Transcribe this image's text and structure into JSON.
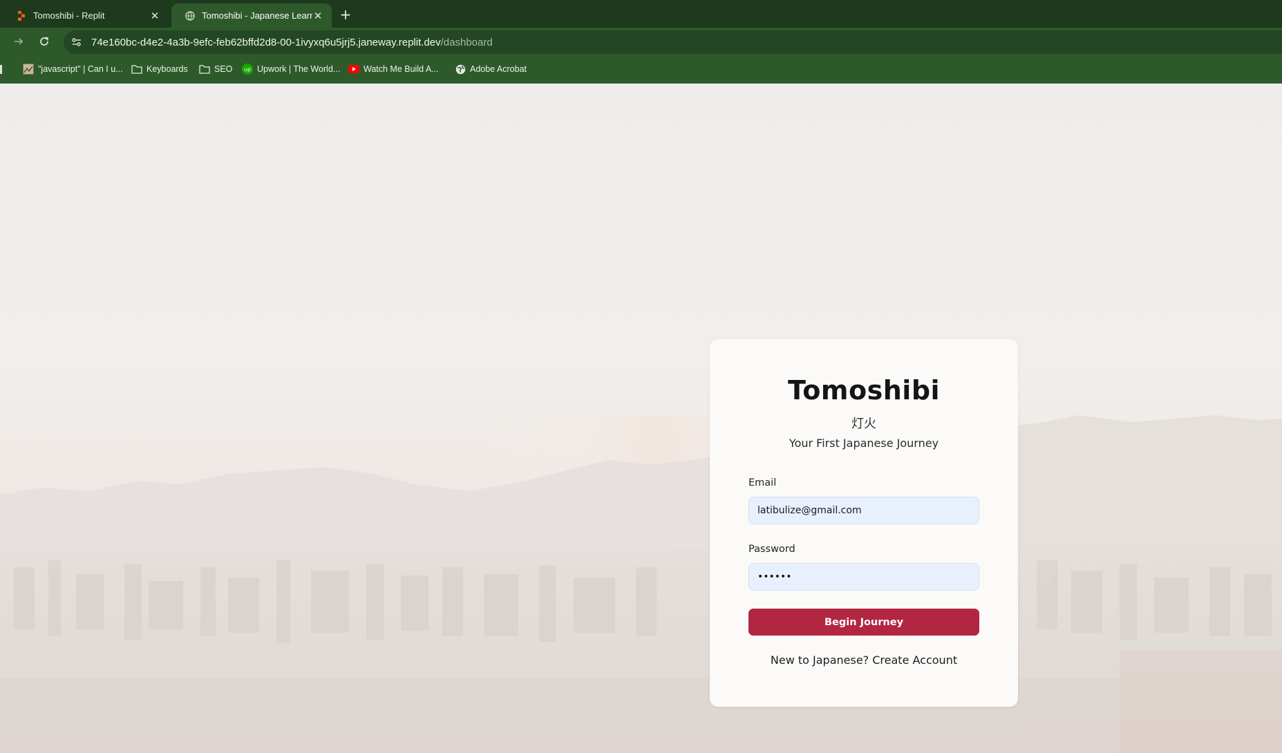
{
  "browser": {
    "tabs": [
      {
        "title": "Tomoshibi - Replit",
        "icon": "replit-icon",
        "active": false
      },
      {
        "title": "Tomoshibi - Japanese Learning",
        "icon": "globe-icon",
        "active": true
      }
    ],
    "new_tab_symbol": "+",
    "close_symbol": "✕",
    "url_host": "74e160bc-d4e2-4a3b-9efc-feb62bffd2d8-00-1ivyxq6u5jrj5.janeway.replit.dev",
    "url_path": "/dashboard",
    "bookmarks": [
      {
        "label": "\"javascript\" | Can I u...",
        "icon": "caniuse-icon"
      },
      {
        "label": "Keyboards",
        "icon": "folder-icon"
      },
      {
        "label": "SEO",
        "icon": "folder-icon"
      },
      {
        "label": "Upwork | The World...",
        "icon": "upwork-icon"
      },
      {
        "label": "Watch Me Build A...",
        "icon": "youtube-icon"
      },
      {
        "label": "Adobe Acrobat",
        "icon": "globe-icon"
      }
    ],
    "colors": {
      "tabbar": "#1e3a1e",
      "toolbar": "#2e5a2b"
    }
  },
  "login": {
    "title": "Tomoshibi",
    "title_kanji": "灯火",
    "tagline": "Your First Japanese Journey",
    "email_label": "Email",
    "email_value": "latibulize@gmail.com",
    "password_label": "Password",
    "password_value": "••••••",
    "submit_label": "Begin Journey",
    "signup_text": "New to Japanese? Create Account",
    "colors": {
      "accent": "#b22641",
      "input_bg": "#e8f0fe",
      "card_bg": "#fbfaf8"
    }
  }
}
